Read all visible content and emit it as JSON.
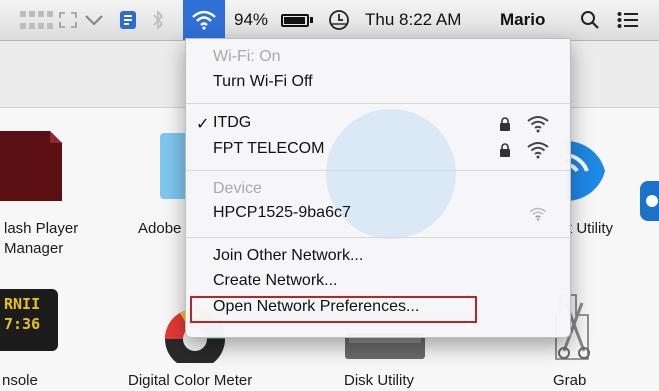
{
  "menubar": {
    "battery_percent": "94%",
    "battery_level": 0.94,
    "clock": "Thu 8:22 AM",
    "user": "Mario"
  },
  "background_apps": [
    {
      "label_line1": "lash Player",
      "label_line2": "Manager"
    },
    {
      "label_line1": "Adobe"
    },
    {
      "label_line1": "t Utility"
    },
    {
      "label_line1": "nsole"
    },
    {
      "label_line1": "Digital Color Meter"
    },
    {
      "label_line1": "Disk Utility"
    },
    {
      "label_line1": "Grab"
    }
  ],
  "console_icon_text": {
    "line1": "RNII",
    "line2": "7:36"
  },
  "wifi_menu": {
    "status": "Wi-Fi: On",
    "toggle": "Turn Wi-Fi Off",
    "check": "✓",
    "networks": [
      {
        "name": "ITDG",
        "selected": true,
        "locked": true
      },
      {
        "name": "FPT TELECOM",
        "selected": false,
        "locked": true
      }
    ],
    "device_header": "Device",
    "device_name": "HPCP1525-9ba6c7",
    "join_other": "Join Other Network...",
    "create_network": "Create Network...",
    "open_prefs": "Open Network Preferences..."
  },
  "colors": {
    "menubar_highlight": "#2f6fd6",
    "annotation_box": "#b3262e"
  }
}
